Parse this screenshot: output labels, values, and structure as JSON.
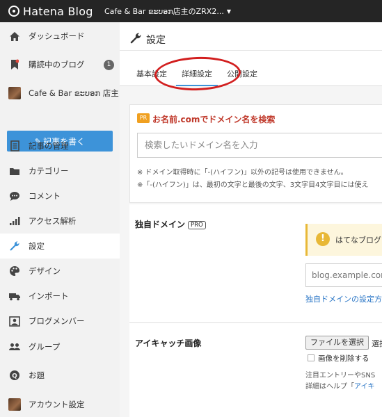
{
  "topbar": {
    "logo": "Hatena Blog",
    "blog_selector": "Cafe & Bar ຂະບອກ店主のZRX2..."
  },
  "sidebar": {
    "items": [
      {
        "label": "ダッシュボード",
        "icon": "home-icon"
      },
      {
        "label": "購読中のブログ",
        "icon": "bookmark-icon",
        "badge": "1"
      },
      {
        "label": "Cafe & Bar ຂະບອກ 店主...",
        "icon": "blog-avatar"
      },
      {
        "label": "記事の管理",
        "icon": "document-icon"
      },
      {
        "label": "カテゴリー",
        "icon": "folder-icon"
      },
      {
        "label": "コメント",
        "icon": "comment-icon"
      },
      {
        "label": "アクセス解析",
        "icon": "bar-chart-icon"
      },
      {
        "label": "設定",
        "icon": "wrench-icon",
        "active": true
      },
      {
        "label": "デザイン",
        "icon": "palette-icon"
      },
      {
        "label": "インポート",
        "icon": "truck-icon"
      },
      {
        "label": "ブログメンバー",
        "icon": "member-icon"
      },
      {
        "label": "グループ",
        "icon": "group-icon"
      },
      {
        "label": "お題",
        "icon": "topic-icon"
      },
      {
        "label": "アカウント設定",
        "icon": "account-avatar"
      }
    ],
    "write_button": "記事を書く"
  },
  "main": {
    "title": "設定",
    "tabs": [
      {
        "label": "基本設定"
      },
      {
        "label": "詳細設定",
        "active": true
      },
      {
        "label": "公開設定"
      }
    ],
    "domain_search": {
      "pr_tag": "PR",
      "title": "お名前.comでドメイン名を検索",
      "placeholder": "検索したいドメイン名を入力",
      "note1": "※ ドメイン取得時に「-(ハイフン)」以外の記号は使用できません。",
      "note2": "※「-(ハイフン)」は、最初の文字と最後の文字、3文字目4文字目には使え"
    },
    "custom_domain": {
      "label": "独自ドメイン",
      "pro": "PRO",
      "warning": "はてなブログ",
      "placeholder": "blog.example.com",
      "link": "独自ドメインの設定方法"
    },
    "eyecatch": {
      "label": "アイキャッチ画像",
      "file_button": "ファイルを選択",
      "file_status": "選択",
      "checkbox_label": "画像を削除する",
      "help1": "注目エントリーやSNS",
      "help2_prefix": "詳細はヘルプ「",
      "help2_link": "アイキ"
    }
  },
  "colors": {
    "accent_blue": "#3d93d9",
    "annotation_red": "#d21f1f",
    "topbar": "#252525"
  }
}
